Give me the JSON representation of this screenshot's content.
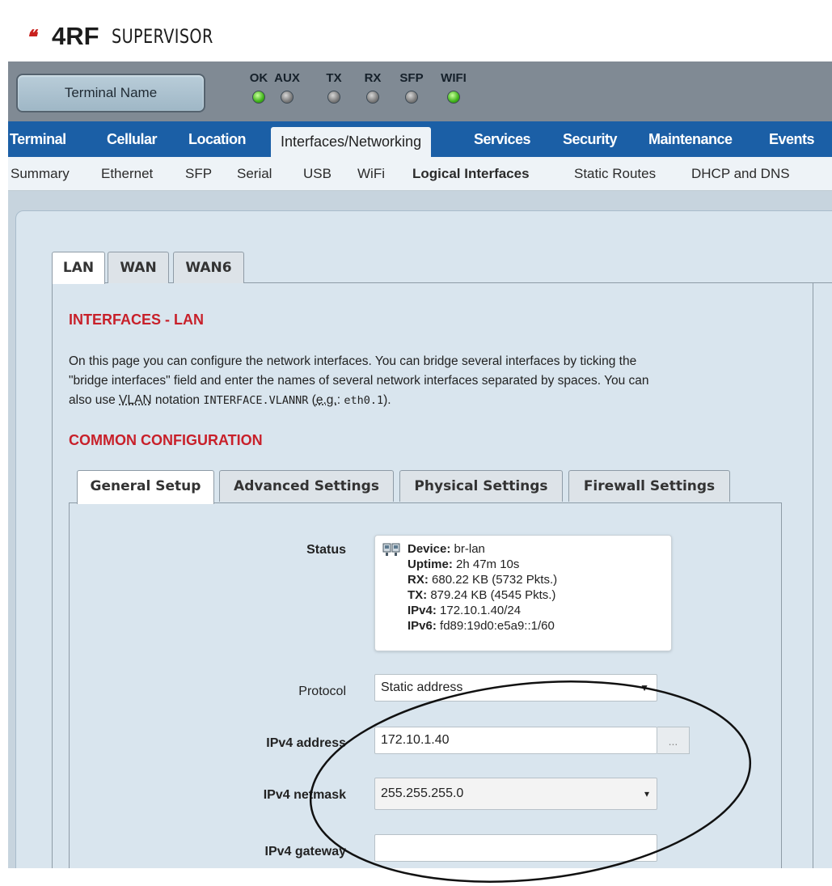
{
  "header": {
    "logo_mark": "❛❛",
    "logo_brand": "4RF",
    "logo_product": "SUPERVISOR"
  },
  "statusbar": {
    "terminal_name": "Terminal Name",
    "leds": [
      {
        "label": "OK",
        "state": "on"
      },
      {
        "label": "AUX",
        "state": "off"
      },
      {
        "label": "TX",
        "state": "off"
      },
      {
        "label": "RX",
        "state": "off"
      },
      {
        "label": "SFP",
        "state": "off"
      },
      {
        "label": "WIFI",
        "state": "on"
      }
    ]
  },
  "mainnav": {
    "items": [
      "Terminal",
      "Cellular",
      "Location",
      "Interfaces/Networking",
      "Services",
      "Security",
      "Maintenance",
      "Events"
    ],
    "active": "Interfaces/Networking"
  },
  "subnav": {
    "items": [
      "Summary",
      "Ethernet",
      "SFP",
      "Serial",
      "USB",
      "WiFi",
      "Logical Interfaces",
      "Static Routes",
      "DHCP and DNS"
    ],
    "active": "Logical Interfaces"
  },
  "iface_tabs": {
    "items": [
      "LAN",
      "WAN",
      "WAN6"
    ],
    "active": "LAN"
  },
  "page": {
    "title": "INTERFACES - LAN",
    "desc_1": "On this page you can configure the network interfaces. You can bridge several interfaces by ticking the",
    "desc_2": "\"bridge interfaces\" field and enter the names of several network interfaces separated by spaces. You can",
    "desc_3a": "also use ",
    "desc_3_vlan": "VLAN",
    "desc_3b": " notation ",
    "desc_3_code": "INTERFACE.VLANNR",
    "desc_3c": " (",
    "desc_3_eg": "e.g.",
    "desc_3d": ": ",
    "desc_3_code2": "eth0.1",
    "desc_3e": ").",
    "common_title": "COMMON CONFIGURATION"
  },
  "config_tabs": {
    "items": [
      "General Setup",
      "Advanced Settings",
      "Physical Settings",
      "Firewall Settings"
    ],
    "active": "General Setup"
  },
  "status": {
    "label": "Status",
    "device_key": "Device:",
    "device_val": " br-lan",
    "uptime_key": "Uptime:",
    "uptime_val": " 2h 47m 10s",
    "rx_key": "RX:",
    "rx_val": " 680.22 KB (5732 Pkts.)",
    "tx_key": "TX:",
    "tx_val": " 879.24 KB (4545 Pkts.)",
    "ipv4_key": "IPv4:",
    "ipv4_val": " 172.10.1.40/24",
    "ipv6_key": "IPv6:",
    "ipv6_val": " fd89:19d0:e5a9::1/60"
  },
  "form": {
    "protocol_label": "Protocol",
    "protocol_value": "Static address",
    "ipv4_address_label": "IPv4 address",
    "ipv4_address_value": "172.10.1.40",
    "ipv4_address_button": "...",
    "ipv4_netmask_label": "IPv4 netmask",
    "ipv4_netmask_value": "255.255.255.0",
    "ipv4_gateway_label": "IPv4 gateway",
    "ipv4_gateway_value": ""
  },
  "colors": {
    "nav_blue": "#1b5fa6",
    "section_red": "#c8202a",
    "status_grey": "#808a94",
    "panel": "#d9e5ee",
    "annotation": "#111111"
  }
}
